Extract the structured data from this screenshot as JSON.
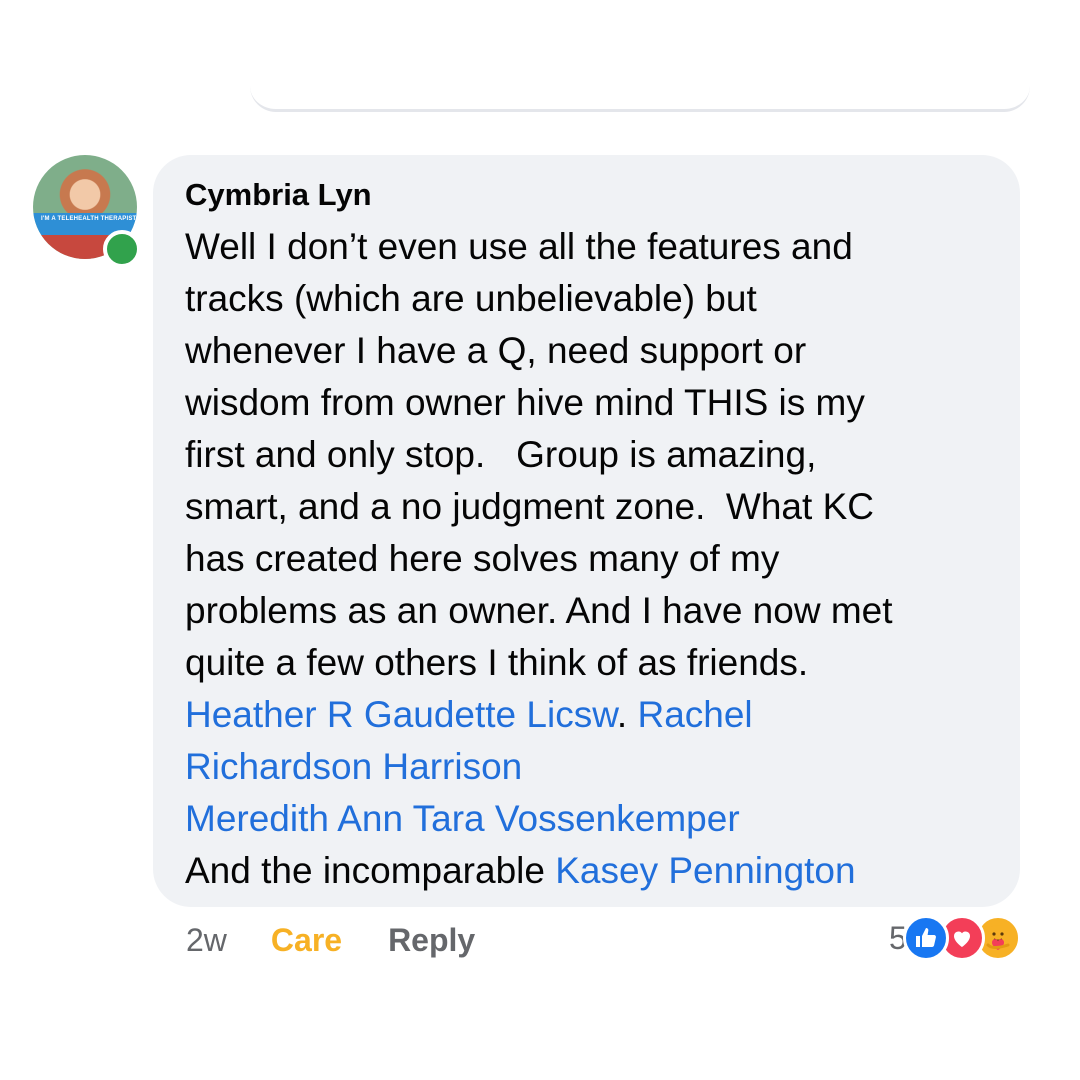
{
  "comment": {
    "author": "Cymbria Lyn",
    "avatar_banner_text": "I'M A TELEHEALTH THERAPIST",
    "lines": [
      [
        {
          "text": "Well I don’t even use all the features and",
          "link": false
        }
      ],
      [
        {
          "text": "tracks (which are unbelievable) but",
          "link": false
        }
      ],
      [
        {
          "text": "whenever I have a Q, need support or",
          "link": false
        }
      ],
      [
        {
          "text": "wisdom from owner hive mind THIS is my",
          "link": false
        }
      ],
      [
        {
          "text": "first and only stop.   Group is amazing,",
          "link": false
        }
      ],
      [
        {
          "text": "smart, and a no judgment zone.  What KC",
          "link": false
        }
      ],
      [
        {
          "text": "has created here solves many of my",
          "link": false
        }
      ],
      [
        {
          "text": "problems as an owner. And I have now met",
          "link": false
        }
      ],
      [
        {
          "text": "quite a few others I think of as friends.",
          "link": false
        }
      ],
      [
        {
          "text": "Heather R Gaudette Licsw",
          "link": true
        },
        {
          "text": ". ",
          "link": false
        },
        {
          "text": "Rachel",
          "link": true
        }
      ],
      [
        {
          "text": "Richardson Harrison",
          "link": true
        }
      ],
      [
        {
          "text": "Meredith Ann Tara Vossenkemper",
          "link": true
        }
      ],
      [
        {
          "text": "And the incomparable ",
          "link": false
        },
        {
          "text": "Kasey Pennington",
          "link": true
        }
      ]
    ]
  },
  "actions": {
    "time": "2w",
    "reaction_label": "Care",
    "reply_label": "Reply"
  },
  "reactions": {
    "count": "5",
    "icons": [
      "like-icon",
      "love-icon",
      "care-icon"
    ]
  },
  "colors": {
    "bubble": "#f0f2f5",
    "mention": "#216fdb",
    "care": "#f7b125",
    "like": "#1877f2",
    "love": "#f33e58",
    "online": "#31a24c"
  }
}
